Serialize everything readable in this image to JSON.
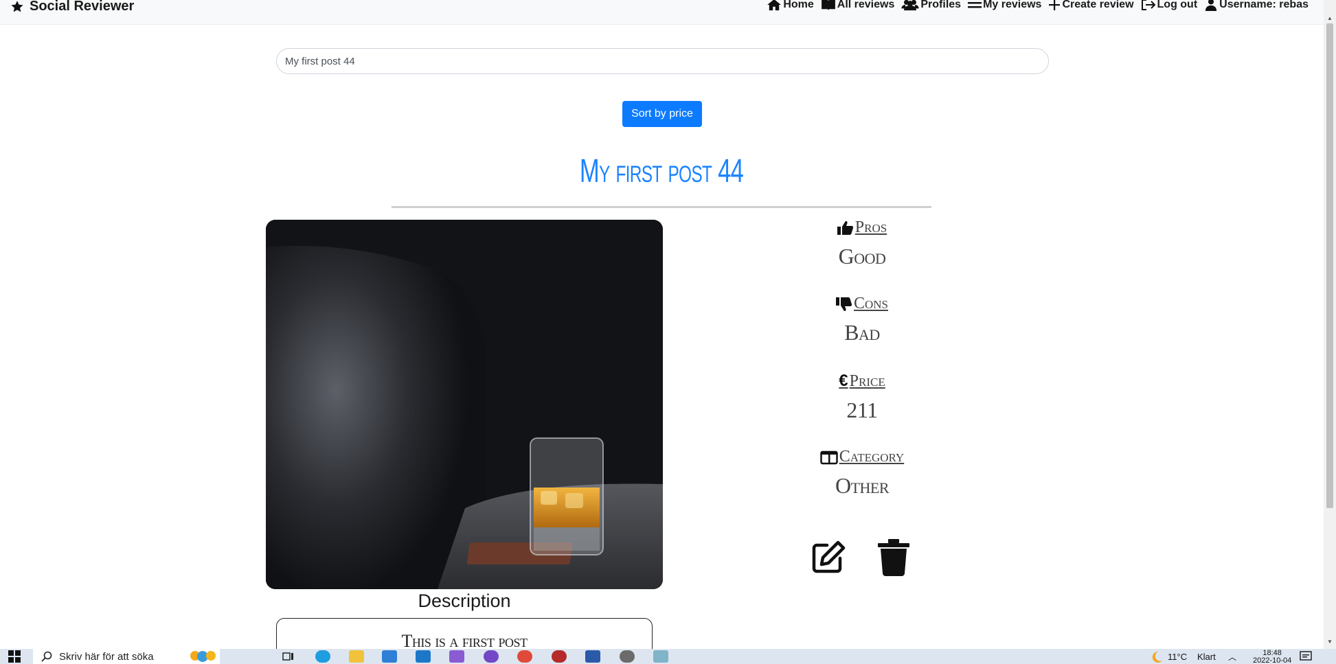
{
  "navbar": {
    "brand": "Social Reviewer",
    "links": [
      {
        "label": "Home",
        "icon": "home-icon"
      },
      {
        "label": "All reviews",
        "icon": "book-icon"
      },
      {
        "label": "Profiles",
        "icon": "users-icon"
      },
      {
        "label": "My reviews",
        "icon": "menu-icon"
      },
      {
        "label": "Create review",
        "icon": "plus-icon"
      },
      {
        "label": "Log out",
        "icon": "logout-icon"
      },
      {
        "label": "Username: rebas",
        "icon": "user-icon"
      }
    ]
  },
  "search": {
    "value": "My first post 44"
  },
  "sort_button": {
    "label": "Sort by price"
  },
  "post": {
    "title": "My first post 44",
    "description_heading": "Description",
    "description": "This is a first post",
    "details": {
      "pros": {
        "label": "Pros",
        "value": "Good"
      },
      "cons": {
        "label": "Cons",
        "value": "Bad"
      },
      "price": {
        "label": "Price",
        "value": "211"
      },
      "category": {
        "label": "Category",
        "value": "Other"
      }
    }
  },
  "taskbar": {
    "search_placeholder": "Skriv här för att söka",
    "weather": "11°C",
    "weather_text": "Klart",
    "time": "18:48",
    "date": "2022-10-04"
  },
  "colors": {
    "accent": "#0d7bff",
    "title": "#1a84ff",
    "navbar_bg": "#f8f9fa"
  }
}
